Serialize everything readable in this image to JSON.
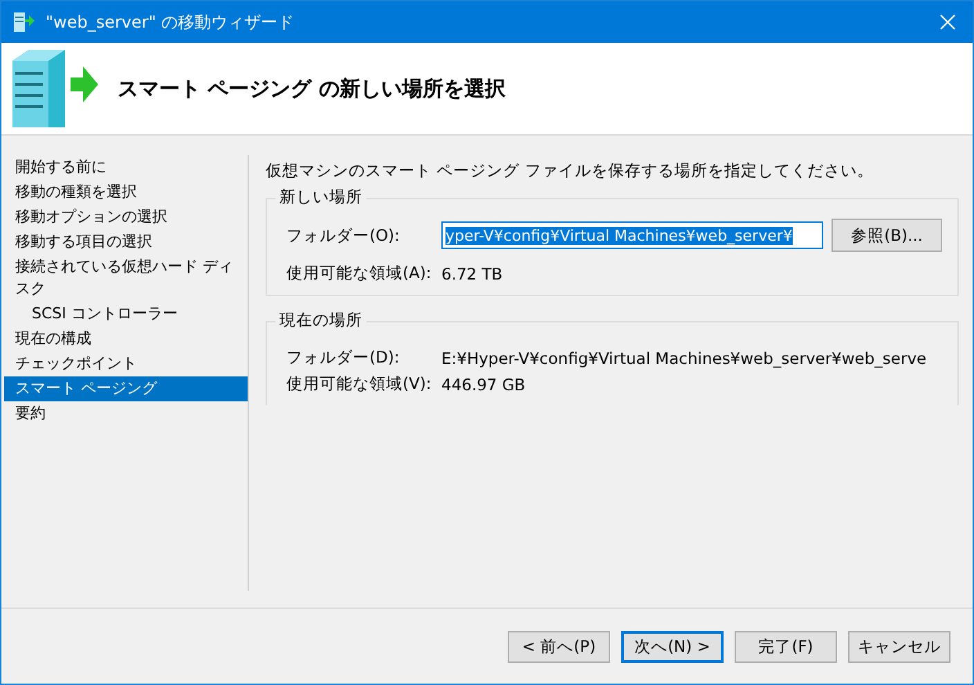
{
  "window": {
    "title": "\"web_server\" の移動ウィザード"
  },
  "header": {
    "title": "スマート ページング の新しい場所を選択"
  },
  "sidebar": {
    "items": [
      {
        "label": "開始する前に",
        "selected": false
      },
      {
        "label": "移動の種類を選択",
        "selected": false
      },
      {
        "label": "移動オプションの選択",
        "selected": false
      },
      {
        "label": "移動する項目の選択",
        "selected": false
      },
      {
        "label": "接続されている仮想ハード ディスク",
        "selected": false,
        "children": [
          {
            "label": "SCSI コントローラー",
            "selected": false
          }
        ]
      },
      {
        "label": "現在の構成",
        "selected": false
      },
      {
        "label": "チェックポイント",
        "selected": false
      },
      {
        "label": "スマート ページング",
        "selected": true
      },
      {
        "label": "要約",
        "selected": false
      }
    ]
  },
  "instruction": "仮想マシンのスマート ページング ファイルを保存する場所を指定してください。",
  "new_location": {
    "title": "新しい場所",
    "folder_label": "フォルダー(O):",
    "folder_value": "yper-V¥config¥Virtual Machines¥web_server¥",
    "text_selected": true,
    "browse_button": "参照(B)...",
    "space_label": "使用可能な領域(A):",
    "space_value": "6.72 TB"
  },
  "current_location": {
    "title": "現在の場所",
    "folder_label": "フォルダー(D):",
    "folder_value": "E:¥Hyper-V¥config¥Virtual Machines¥web_server¥web_serve",
    "space_label": "使用可能な領域(V):",
    "space_value": "446.97 GB"
  },
  "buttons": [
    {
      "label": "< 前へ(P)",
      "default": false
    },
    {
      "label": "次へ(N) >",
      "default": true
    },
    {
      "label": "完了(F)",
      "default": false
    },
    {
      "label": "キャンセル",
      "default": false
    }
  ]
}
